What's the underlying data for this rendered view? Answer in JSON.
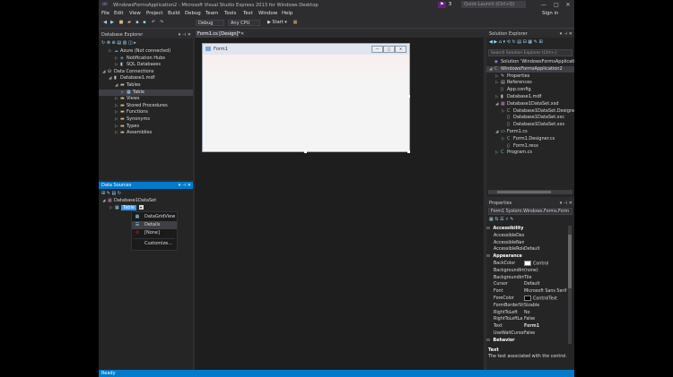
{
  "window": {
    "title": "WindowsFormsApplication2 - Microsoft Visual Studio Express 2013 for Windows Desktop",
    "quick_launch_placeholder": "Quick Launch (Ctrl+Q)",
    "notification_count": "3",
    "sign_in": "Sign in",
    "minimize": "—",
    "maximize": "□",
    "close": "✕"
  },
  "menu": [
    "File",
    "Edit",
    "View",
    "Project",
    "Build",
    "Debug",
    "Team",
    "Tools",
    "Test",
    "Window",
    "Help"
  ],
  "toolbar": {
    "config": "Debug",
    "platform": "Any CPU",
    "start": "▶ Start ▾"
  },
  "server_explorer": {
    "title": "Database Explorer",
    "items": [
      {
        "label": "Azure (Not connected)",
        "indent": 1,
        "arrow": "▷",
        "icon": "azure-icon"
      },
      {
        "label": "Notification Hubs",
        "indent": 2,
        "arrow": "▷",
        "icon": "hub-icon"
      },
      {
        "label": "SQL Databases",
        "indent": 2,
        "arrow": "▷",
        "icon": "db-icon"
      },
      {
        "label": "Data Connections",
        "indent": 0,
        "arrow": "◢",
        "icon": "connection-icon"
      },
      {
        "label": "Database1.mdf",
        "indent": 1,
        "arrow": "◢",
        "icon": "db-icon"
      },
      {
        "label": "Tables",
        "indent": 2,
        "arrow": "◢",
        "icon": "folder-icon"
      },
      {
        "label": "Table",
        "indent": 3,
        "arrow": "▷",
        "icon": "table-icon",
        "selected": true
      },
      {
        "label": "Views",
        "indent": 2,
        "arrow": "▷",
        "icon": "folder-icon"
      },
      {
        "label": "Stored Procedures",
        "indent": 2,
        "arrow": "▷",
        "icon": "folder-icon"
      },
      {
        "label": "Functions",
        "indent": 2,
        "arrow": "▷",
        "icon": "folder-icon"
      },
      {
        "label": "Synonyms",
        "indent": 2,
        "arrow": "▷",
        "icon": "folder-icon"
      },
      {
        "label": "Types",
        "indent": 2,
        "arrow": "▷",
        "icon": "folder-icon"
      },
      {
        "label": "Assemblies",
        "indent": 2,
        "arrow": "▷",
        "icon": "folder-icon"
      }
    ]
  },
  "data_sources": {
    "title": "Data Sources",
    "dataset": "Database1DataSet",
    "table_node": "Table",
    "context_menu": [
      {
        "label": "DataGridView",
        "icon": "grid-icon"
      },
      {
        "label": "Details",
        "icon": "details-icon",
        "hover": true
      },
      {
        "label": "[None]",
        "icon": "none-icon"
      },
      {
        "label": "Customize...",
        "icon": ""
      }
    ]
  },
  "designer": {
    "tab_label": "Form1.cs [Design]*",
    "form_title": "Form1"
  },
  "solution_explorer": {
    "title": "Solution Explorer",
    "search_placeholder": "Search Solution Explorer (Ctrl+;)",
    "items": [
      {
        "label": "Solution 'WindowsFormsApplication2' (1 project)",
        "indent": 0,
        "arrow": "",
        "icon": "solution-icon"
      },
      {
        "label": "WindowsFormsApplication2",
        "indent": 0,
        "arrow": "◢",
        "icon": "csharp-project-icon",
        "selected": true
      },
      {
        "label": "Properties",
        "indent": 1,
        "arrow": "▷",
        "icon": "wrench-icon"
      },
      {
        "label": "References",
        "indent": 1,
        "arrow": "▷",
        "icon": "references-icon"
      },
      {
        "label": "App.config",
        "indent": 1,
        "arrow": "",
        "icon": "config-icon"
      },
      {
        "label": "Database1.mdf",
        "indent": 1,
        "arrow": "▷",
        "icon": "db-icon"
      },
      {
        "label": "Database1DataSet.xsd",
        "indent": 1,
        "arrow": "◢",
        "icon": "xsd-icon"
      },
      {
        "label": "Database1DataSet.Designer.cs",
        "indent": 2,
        "arrow": "▷",
        "icon": "cs-icon"
      },
      {
        "label": "Database1DataSet.xsc",
        "indent": 2,
        "arrow": "",
        "icon": "file-icon"
      },
      {
        "label": "Database1DataSet.xss",
        "indent": 2,
        "arrow": "",
        "icon": "file-icon"
      },
      {
        "label": "Form1.cs",
        "indent": 1,
        "arrow": "◢",
        "icon": "form-icon"
      },
      {
        "label": "Form1.Designer.cs",
        "indent": 2,
        "arrow": "▷",
        "icon": "cs-icon"
      },
      {
        "label": "Form1.resx",
        "indent": 2,
        "arrow": "",
        "icon": "file-icon"
      },
      {
        "label": "Program.cs",
        "indent": 1,
        "arrow": "▷",
        "icon": "cs-icon"
      }
    ]
  },
  "properties": {
    "title": "Properties",
    "object": "Form1 System.Windows.Forms.Form",
    "rows": [
      {
        "kind": "cat",
        "name": "Accessibility"
      },
      {
        "kind": "prop",
        "name": "AccessibleDesc",
        "value": ""
      },
      {
        "kind": "prop",
        "name": "AccessibleName",
        "value": ""
      },
      {
        "kind": "prop",
        "name": "AccessibleRole",
        "value": "Default"
      },
      {
        "kind": "cat",
        "name": "Appearance"
      },
      {
        "kind": "prop",
        "name": "BackColor",
        "value": "Control",
        "swatch": "#ffffff"
      },
      {
        "kind": "prop",
        "name": "BackgroundIm",
        "value": "(none)"
      },
      {
        "kind": "prop",
        "name": "BackgroundIm",
        "value": "Tile"
      },
      {
        "kind": "prop",
        "name": "Cursor",
        "value": "Default"
      },
      {
        "kind": "prop",
        "name": "Font",
        "value": "Microsoft Sans Serif"
      },
      {
        "kind": "prop",
        "name": "ForeColor",
        "value": "ControlText",
        "swatch": "#000000"
      },
      {
        "kind": "prop",
        "name": "FormBorderSty",
        "value": "Sizable"
      },
      {
        "kind": "prop",
        "name": "RightToLeft",
        "value": "No"
      },
      {
        "kind": "prop",
        "name": "RightToLeftLa",
        "value": "False"
      },
      {
        "kind": "prop",
        "name": "Text",
        "value": "Form1",
        "bold": true
      },
      {
        "kind": "prop",
        "name": "UseWaitCursor",
        "value": "False"
      },
      {
        "kind": "cat",
        "name": "Behavior"
      }
    ],
    "help_title": "Text",
    "help_text": "The text associated with the control."
  },
  "status": {
    "text": "Ready"
  }
}
